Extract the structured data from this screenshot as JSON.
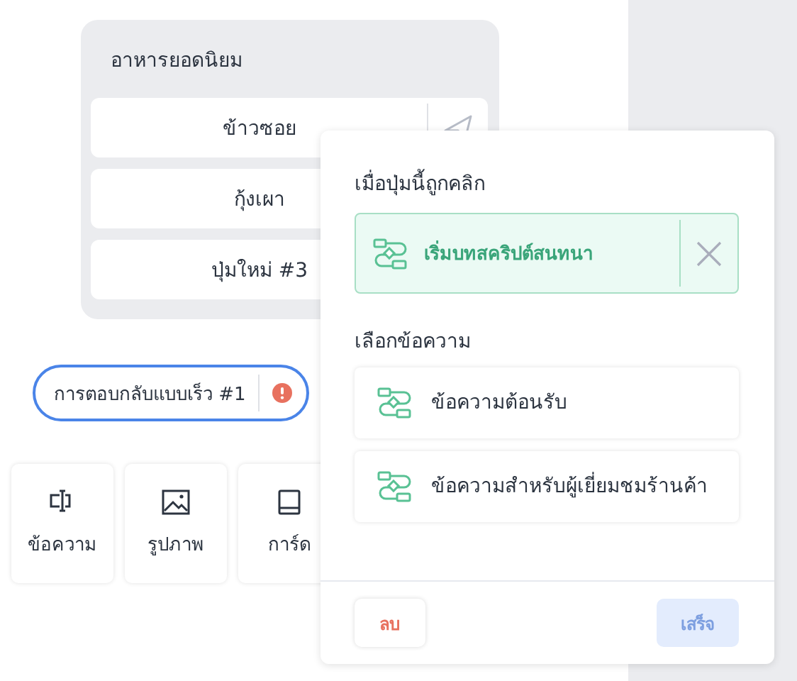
{
  "menu_card": {
    "title": "อาหารยอดนิยม",
    "buttons": [
      {
        "label": "ข้าวซอย"
      },
      {
        "label": "กุ้งเผา"
      },
      {
        "label": "ปุ่มใหม่ #3"
      }
    ]
  },
  "quick_reply": {
    "label": "การตอบกลับแบบเร็ว #1",
    "error": true
  },
  "tiles": [
    {
      "label": "ข้อความ",
      "kind": "text"
    },
    {
      "label": "รูปภาพ",
      "kind": "image"
    },
    {
      "label": "การ์ด",
      "kind": "card"
    }
  ],
  "popover": {
    "action_label": "เมื่อปุ่มนี้ถูกคลิก",
    "action": {
      "label": "เริ่มบทสคริปต์สนทนา"
    },
    "messages_label": "เลือกข้อความ",
    "messages": [
      {
        "label": "ข้อความต้อนรับ"
      },
      {
        "label": "ข้อความสำหรับผู้เยี่ยมชมร้านค้า"
      }
    ],
    "delete_button": "ลบ",
    "done_button": {
      "label": "เสร็จ",
      "disabled": true
    }
  }
}
